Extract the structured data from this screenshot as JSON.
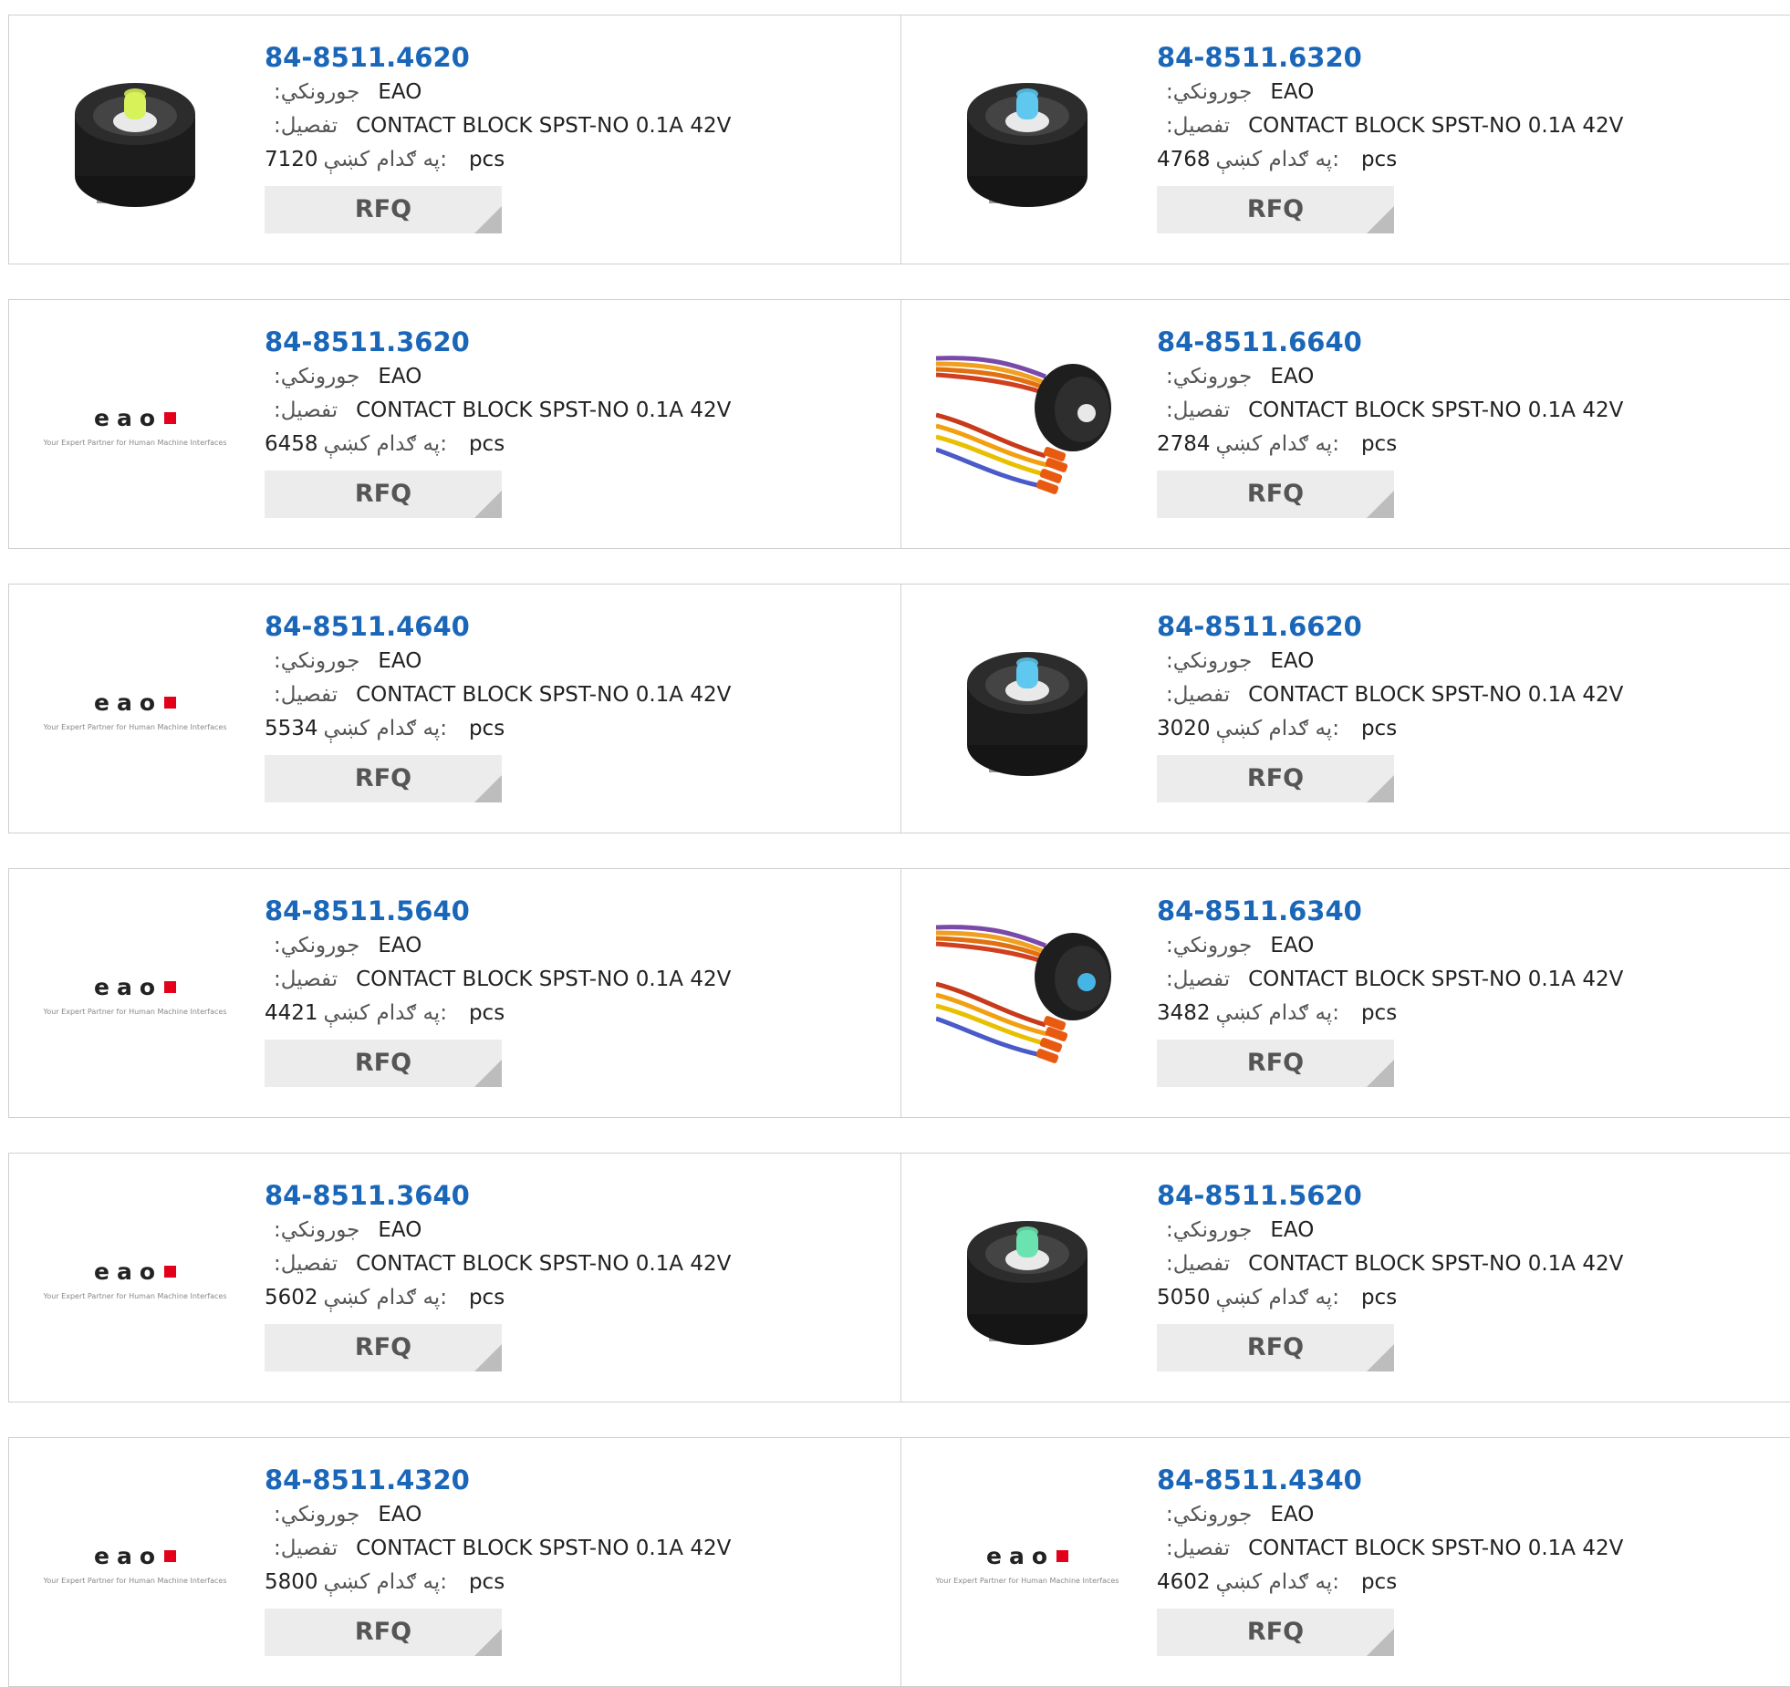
{
  "labels": {
    "manufacturer": ":جورونکي",
    "description": ":تفصیل",
    "stock": "په ګدام کښې:",
    "unit": "pcs",
    "rfq": "RFQ"
  },
  "logo": {
    "word": "eao",
    "tagline": "Your Expert Partner for Human Machine Interfaces"
  },
  "colors": {
    "part_number": "#1a66b8",
    "rfq_bg": "#ececec",
    "logo_square": "#e3001b"
  },
  "products": [
    {
      "part": "84-8511.4620",
      "manufacturer": "EAO",
      "description": "CONTACT BLOCK SPST-NO 0.1A 42V",
      "stock": "7120",
      "image": "contact-block-yellow-green-led"
    },
    {
      "part": "84-8511.6320",
      "manufacturer": "EAO",
      "description": "CONTACT BLOCK SPST-NO 0.1A 42V",
      "stock": "4768",
      "image": "contact-block-blue-led"
    },
    {
      "part": "84-8511.3620",
      "manufacturer": "EAO",
      "description": "CONTACT BLOCK SPST-NO 0.1A 42V",
      "stock": "6458",
      "image": "eao-logo"
    },
    {
      "part": "84-8511.6640",
      "manufacturer": "EAO",
      "description": "CONTACT BLOCK SPST-NO 0.1A 42V",
      "stock": "2784",
      "image": "contact-block-wired"
    },
    {
      "part": "84-8511.4640",
      "manufacturer": "EAO",
      "description": "CONTACT BLOCK SPST-NO 0.1A 42V",
      "stock": "5534",
      "image": "eao-logo"
    },
    {
      "part": "84-8511.6620",
      "manufacturer": "EAO",
      "description": "CONTACT BLOCK SPST-NO 0.1A 42V",
      "stock": "3020",
      "image": "contact-block-blue-led"
    },
    {
      "part": "84-8511.5640",
      "manufacturer": "EAO",
      "description": "CONTACT BLOCK SPST-NO 0.1A 42V",
      "stock": "4421",
      "image": "eao-logo"
    },
    {
      "part": "84-8511.6340",
      "manufacturer": "EAO",
      "description": "CONTACT BLOCK SPST-NO 0.1A 42V",
      "stock": "3482",
      "image": "contact-block-wired-blue"
    },
    {
      "part": "84-8511.3640",
      "manufacturer": "EAO",
      "description": "CONTACT BLOCK SPST-NO 0.1A 42V",
      "stock": "5602",
      "image": "eao-logo"
    },
    {
      "part": "84-8511.5620",
      "manufacturer": "EAO",
      "description": "CONTACT BLOCK SPST-NO 0.1A 42V",
      "stock": "5050",
      "image": "contact-block-green-led"
    },
    {
      "part": "84-8511.4320",
      "manufacturer": "EAO",
      "description": "CONTACT BLOCK SPST-NO 0.1A 42V",
      "stock": "5800",
      "image": "eao-logo"
    },
    {
      "part": "84-8511.4340",
      "manufacturer": "EAO",
      "description": "CONTACT BLOCK SPST-NO 0.1A 42V",
      "stock": "4602",
      "image": "eao-logo"
    }
  ]
}
